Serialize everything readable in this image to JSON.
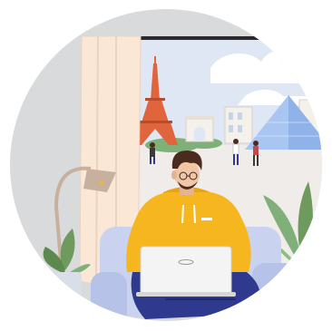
{
  "scene": {
    "kind": "illustration",
    "subject": "person-working-on-laptop-with-paris-view",
    "alt": ""
  },
  "palette": {
    "background_circle": "#d9dadb",
    "sky": "#dfe7f5",
    "cloud": "#ffffff",
    "window_frame": "#2a2a2a",
    "floor_view": "#f0ece9",
    "eiffel_tower": "#e0643c",
    "louvre_glass": "#a9c6f2",
    "curtain": "#fbe7d6",
    "sofa": "#c9d3f0",
    "hoodie": "#f6b61f",
    "pants": "#2f3a8f",
    "laptop": "#f4f4f4",
    "hair": "#4a2b1d",
    "skin": "#f2c6a4",
    "plant": "#6e9a5e",
    "lamp": "#c7b19e"
  }
}
